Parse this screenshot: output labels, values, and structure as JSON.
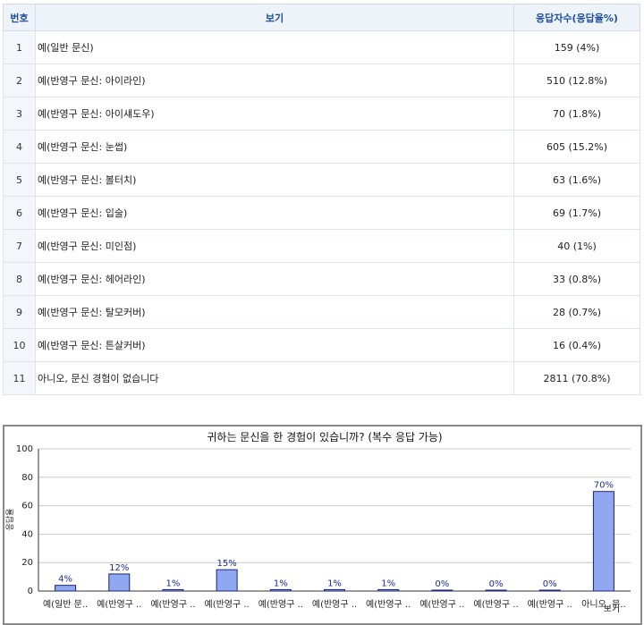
{
  "table": {
    "headers": [
      "번호",
      "보기",
      "응답자수(응답율%)"
    ],
    "rows": [
      {
        "no": "1",
        "option": "예(일반 문신)",
        "result": "159 (4%)"
      },
      {
        "no": "2",
        "option": "예(반영구 문신: 아이라인)",
        "result": "510 (12.8%)"
      },
      {
        "no": "3",
        "option": "예(반영구 문신: 아이섀도우)",
        "result": "70 (1.8%)"
      },
      {
        "no": "4",
        "option": "예(반영구 문신: 눈썹)",
        "result": "605 (15.2%)"
      },
      {
        "no": "5",
        "option": "예(반영구 문신: 볼터치)",
        "result": "63 (1.6%)"
      },
      {
        "no": "6",
        "option": "예(반영구 문신: 입술)",
        "result": "69 (1.7%)"
      },
      {
        "no": "7",
        "option": "예(반영구 문신: 미인점)",
        "result": "40 (1%)"
      },
      {
        "no": "8",
        "option": "예(반영구 문신: 헤어라인)",
        "result": "33 (0.8%)"
      },
      {
        "no": "9",
        "option": "예(반영구 문신: 탈모커버)",
        "result": "28 (0.7%)"
      },
      {
        "no": "10",
        "option": "예(반영구 문신: 튼살커버)",
        "result": "16 (0.4%)"
      },
      {
        "no": "11",
        "option": "아니오, 문신 경험이 없습니다",
        "result": "2811 (70.8%)"
      }
    ]
  },
  "chart_data": {
    "type": "bar",
    "title": "귀하는 문신을 한 경험이 있습니까? (복수 응답 가능)",
    "xlabel": "보기",
    "ylabel": "응답율",
    "ylim": [
      0,
      100
    ],
    "yticks": [
      0,
      20,
      40,
      60,
      80,
      100
    ],
    "grid": true,
    "categories": [
      "예(일반 문..",
      "예(반영구 ..",
      "예(반영구 ..",
      "예(반영구 ..",
      "예(반영구 ..",
      "예(반영구 ..",
      "예(반영구 ..",
      "예(반영구 ..",
      "예(반영구 ..",
      "예(반영구 ..",
      "아니오, 문.."
    ],
    "values": [
      4,
      12,
      1,
      15,
      1,
      1,
      1,
      0,
      0,
      0,
      70
    ],
    "data_labels": [
      "4%",
      "12%",
      "1%",
      "15%",
      "1%",
      "1%",
      "1%",
      "0%",
      "0%",
      "0%",
      "70%"
    ],
    "bar_color": "#8fa8ef",
    "bar_stroke": "#1a237e"
  }
}
